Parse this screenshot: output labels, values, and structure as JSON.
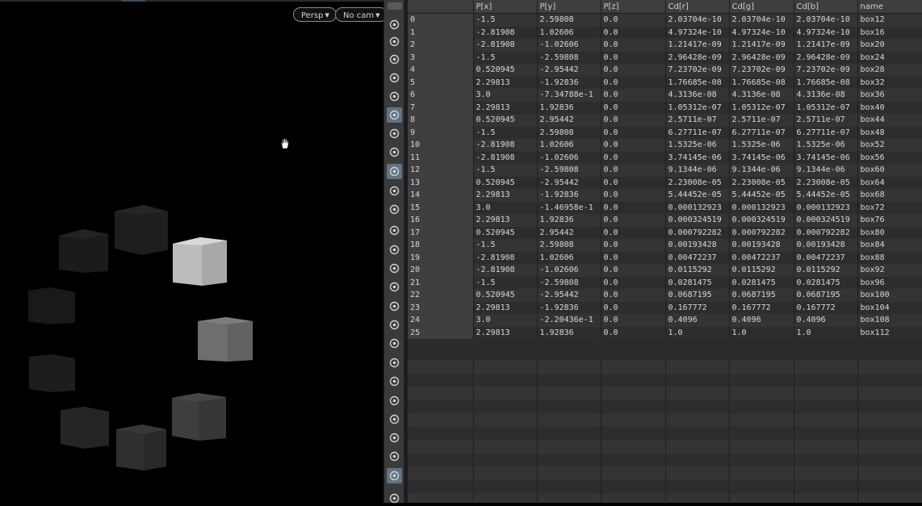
{
  "viewport": {
    "persp_label": "Persp",
    "cam_label": "No cam"
  },
  "shelf_tools": [
    "camera-view-icon",
    "geometry-display-icon",
    "lock-icon",
    "ghost-toggle-icon",
    "orbit-icon",
    "light-bulb-icon",
    "headlight-icon",
    "point-light-icon",
    "shaded-sphere-icon",
    "visibility-icon",
    "render-view-icon",
    "point-icon",
    "normal-icon",
    "pen-icon",
    "point-numbers-icon",
    "fill-icon",
    "primitive-numbers-icon",
    "curve-icon",
    "shading-icon",
    "checker-icon",
    "diamond-icon",
    "texture-icon",
    "axis-icon",
    "snapshot-icon",
    "background-image-icon",
    "settings-icon"
  ],
  "spreadsheet": {
    "columns": [
      "",
      "P[x]",
      "P[y]",
      "P[z]",
      "Cd[r]",
      "Cd[g]",
      "Cd[b]",
      "name"
    ],
    "rows": [
      [
        "0",
        "-1.5",
        "2.59808",
        "0.0",
        "2.03704e-10",
        "2.03704e-10",
        "2.03704e-10",
        "box12"
      ],
      [
        "1",
        "-2.81908",
        "1.02606",
        "0.0",
        "4.97324e-10",
        "4.97324e-10",
        "4.97324e-10",
        "box16"
      ],
      [
        "2",
        "-2.81908",
        "-1.02606",
        "0.0",
        "1.21417e-09",
        "1.21417e-09",
        "1.21417e-09",
        "box20"
      ],
      [
        "3",
        "-1.5",
        "-2.59808",
        "0.0",
        "2.96428e-09",
        "2.96428e-09",
        "2.96428e-09",
        "box24"
      ],
      [
        "4",
        "0.520945",
        "-2.95442",
        "0.0",
        "7.23702e-09",
        "7.23702e-09",
        "7.23702e-09",
        "box28"
      ],
      [
        "5",
        "2.29813",
        "-1.92836",
        "0.0",
        "1.76685e-08",
        "1.76685e-08",
        "1.76685e-08",
        "box32"
      ],
      [
        "6",
        "3.0",
        "-7.34788e-1",
        "0.0",
        "4.3136e-08",
        "4.3136e-08",
        "4.3136e-08",
        "box36"
      ],
      [
        "7",
        "2.29813",
        "1.92836",
        "0.0",
        "1.05312e-07",
        "1.05312e-07",
        "1.05312e-07",
        "box40"
      ],
      [
        "8",
        "0.520945",
        "2.95442",
        "0.0",
        "2.5711e-07",
        "2.5711e-07",
        "2.5711e-07",
        "box44"
      ],
      [
        "9",
        "-1.5",
        "2.59808",
        "0.0",
        "6.27711e-07",
        "6.27711e-07",
        "6.27711e-07",
        "box48"
      ],
      [
        "10",
        "-2.81908",
        "1.02606",
        "0.0",
        "1.5325e-06",
        "1.5325e-06",
        "1.5325e-06",
        "box52"
      ],
      [
        "11",
        "-2.81908",
        "-1.02606",
        "0.0",
        "3.74145e-06",
        "3.74145e-06",
        "3.74145e-06",
        "box56"
      ],
      [
        "12",
        "-1.5",
        "-2.59808",
        "0.0",
        "9.1344e-06",
        "9.1344e-06",
        "9.1344e-06",
        "box60"
      ],
      [
        "13",
        "0.520945",
        "-2.95442",
        "0.0",
        "2.23008e-05",
        "2.23008e-05",
        "2.23008e-05",
        "box64"
      ],
      [
        "14",
        "2.29813",
        "-1.92836",
        "0.0",
        "5.44452e-05",
        "5.44452e-05",
        "5.44452e-05",
        "box68"
      ],
      [
        "15",
        "3.0",
        "-1.46958e-1",
        "0.0",
        "0.000132923",
        "0.000132923",
        "0.000132923",
        "box72"
      ],
      [
        "16",
        "2.29813",
        "1.92836",
        "0.0",
        "0.000324519",
        "0.000324519",
        "0.000324519",
        "box76"
      ],
      [
        "17",
        "0.520945",
        "2.95442",
        "0.0",
        "0.000792282",
        "0.000792282",
        "0.000792282",
        "box80"
      ],
      [
        "18",
        "-1.5",
        "2.59808",
        "0.0",
        "0.00193428",
        "0.00193428",
        "0.00193428",
        "box84"
      ],
      [
        "19",
        "-2.81908",
        "1.02606",
        "0.0",
        "0.00472237",
        "0.00472237",
        "0.00472237",
        "box88"
      ],
      [
        "20",
        "-2.81908",
        "-1.02606",
        "0.0",
        "0.0115292",
        "0.0115292",
        "0.0115292",
        "box92"
      ],
      [
        "21",
        "-1.5",
        "-2.59808",
        "0.0",
        "0.0281475",
        "0.0281475",
        "0.0281475",
        "box96"
      ],
      [
        "22",
        "0.520945",
        "-2.95442",
        "0.0",
        "0.0687195",
        "0.0687195",
        "0.0687195",
        "box100"
      ],
      [
        "23",
        "2.29813",
        "-1.92836",
        "0.0",
        "0.167772",
        "0.167772",
        "0.167772",
        "box104"
      ],
      [
        "24",
        "3.0",
        "-2.20436e-1",
        "0.0",
        "0.4096",
        "0.4096",
        "0.4096",
        "box108"
      ],
      [
        "25",
        "2.29813",
        "1.92836",
        "0.0",
        "1.0",
        "1.0",
        "1.0",
        "box112"
      ]
    ]
  }
}
